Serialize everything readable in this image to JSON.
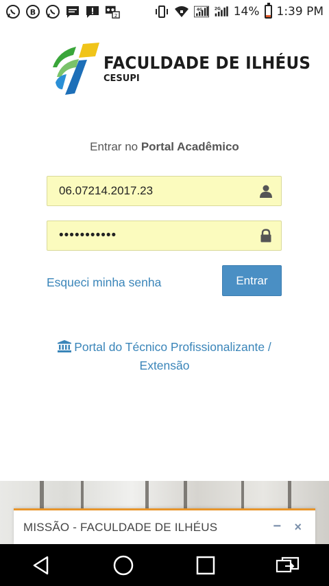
{
  "status_bar": {
    "left_icons": [
      "whatsapp-icon",
      "bbm-icon",
      "whatsapp-icon",
      "message-icon",
      "alert-message-icon",
      "voicemail-icon"
    ],
    "battery_percent": "14%",
    "battery_level": 0.14,
    "time": "1:39 PM",
    "network_1": "4G",
    "network_2": "2G"
  },
  "logo": {
    "title": "FACULDADE DE ILHÉUS",
    "subtitle": "CESUPI"
  },
  "login": {
    "prompt_prefix": "Entrar no ",
    "prompt_strong": "Portal Acadêmico",
    "username_value": "06.07214.2017.23",
    "password_value": "•••••••••••",
    "forgot_label": "Esqueci minha senha",
    "submit_label": "Entrar"
  },
  "portal_link": {
    "label": "Portal do Técnico Profissionalizante / Extensão",
    "icon": "institution-icon"
  },
  "mission_bar": {
    "title": "MISSÃO - FACULDADE DE ILHÉUS",
    "minimize_label": "−",
    "close_label": "×"
  },
  "colors": {
    "accent_blue": "#4a8fc4",
    "link_blue": "#3a85b9",
    "field_yellow": "#fbfbbe",
    "mission_border": "#e8952a"
  }
}
